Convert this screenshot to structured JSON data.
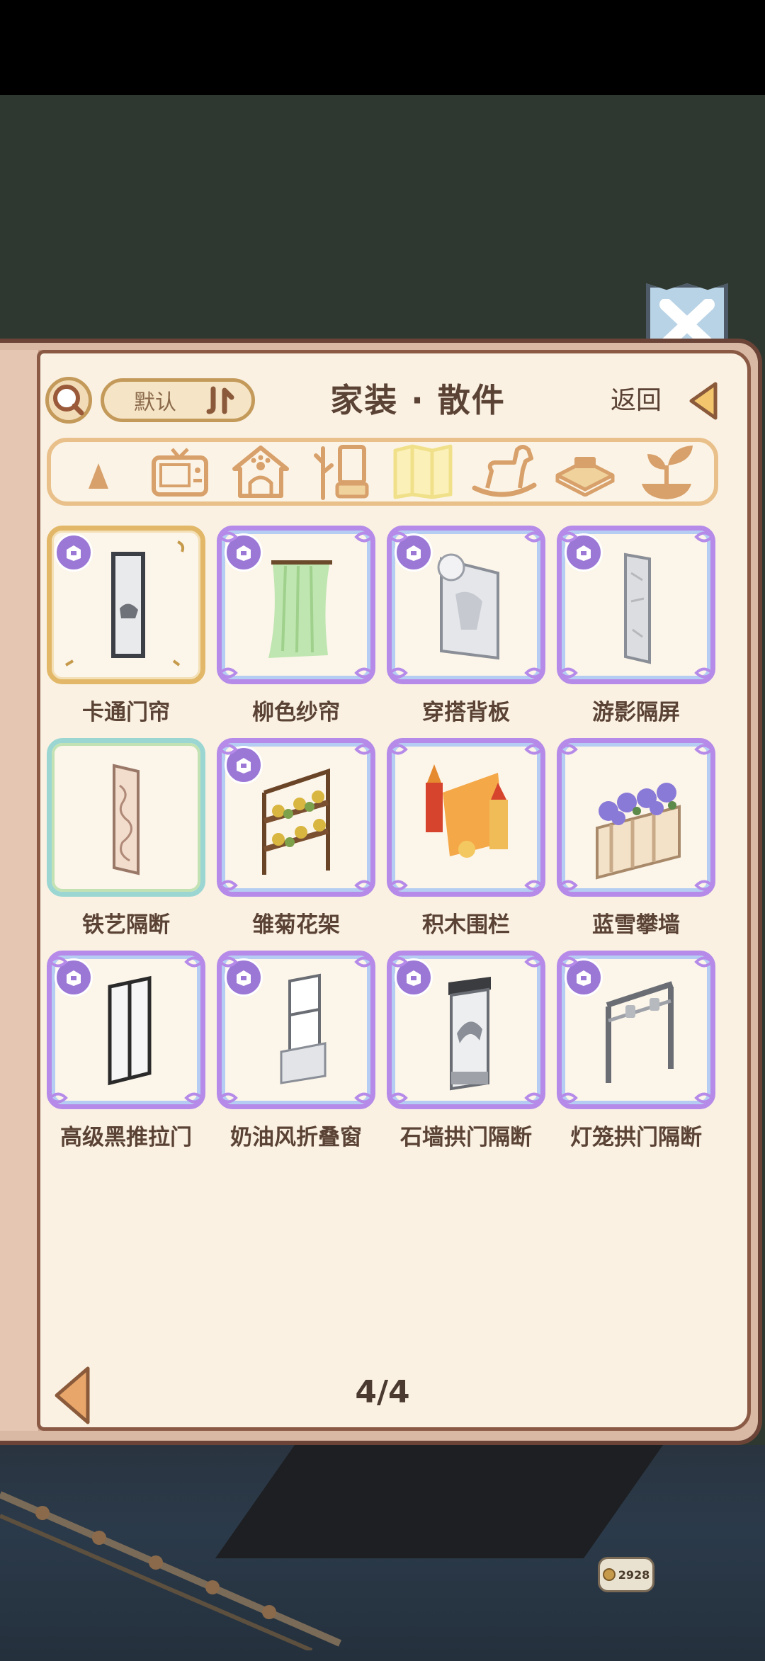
{
  "header": {
    "title": "家装 · 散件",
    "sort_label": "默认",
    "back_label": "返回"
  },
  "categories": [
    {
      "icon": "lamp-icon",
      "selected": false
    },
    {
      "icon": "tv-icon",
      "selected": false
    },
    {
      "icon": "pet-house-icon",
      "selected": false
    },
    {
      "icon": "plant-stand-icon",
      "selected": false
    },
    {
      "icon": "folding-screen-icon",
      "selected": true
    },
    {
      "icon": "rocking-horse-icon",
      "selected": false
    },
    {
      "icon": "rug-icon",
      "selected": false
    },
    {
      "icon": "sprout-icon",
      "selected": false
    }
  ],
  "items": [
    {
      "name": "卡通门帘",
      "rarity": "gold"
    },
    {
      "name": "柳色纱帘",
      "rarity": "purple"
    },
    {
      "name": "穿搭背板",
      "rarity": "purple"
    },
    {
      "name": "游影隔屏",
      "rarity": "purple"
    },
    {
      "name": "铁艺隔断",
      "rarity": "teal"
    },
    {
      "name": "雏菊花架",
      "rarity": "purple"
    },
    {
      "name": "积木围栏",
      "rarity": "purple"
    },
    {
      "name": "蓝雪攀墙",
      "rarity": "purple"
    },
    {
      "name": "高级黑推拉门",
      "rarity": "purple"
    },
    {
      "name": "奶油风折叠窗",
      "rarity": "purple"
    },
    {
      "name": "石墙拱门隔断",
      "rarity": "purple"
    },
    {
      "name": "灯笼拱门隔断",
      "rarity": "purple"
    }
  ],
  "pager": {
    "text": "4/4"
  },
  "coins": {
    "value": "2928"
  },
  "colors": {
    "page": "#faf1e3",
    "text": "#5a4234",
    "accent_gold": "#e2b868",
    "accent_purple": "#b58ae8"
  }
}
